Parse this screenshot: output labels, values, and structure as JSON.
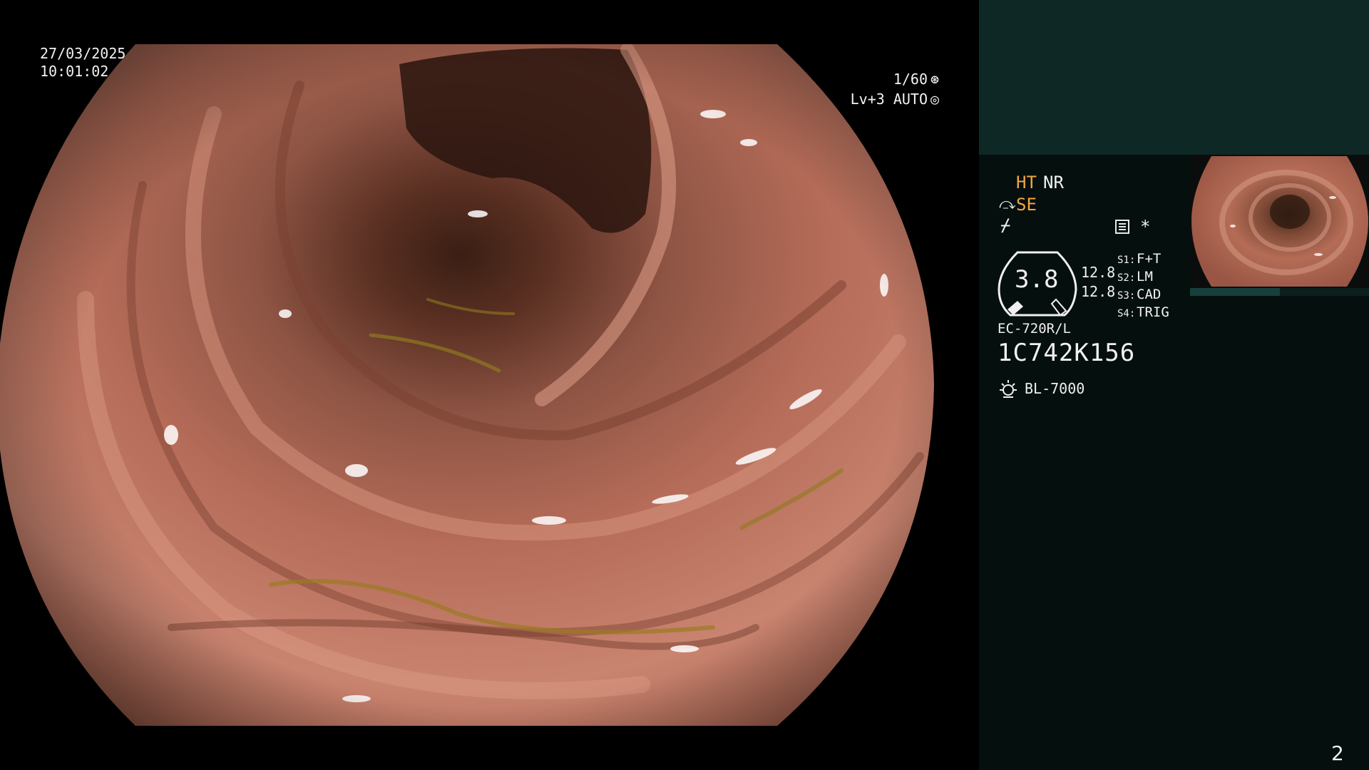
{
  "overlay": {
    "date": "27/03/2025",
    "time": "10:01:02",
    "shutter": "1/60",
    "shutter_icon": "shutter-icon",
    "level": "Lv+3 AUTO",
    "iris_icon": "iris-icon"
  },
  "panel": {
    "modes": {
      "ht": "HT",
      "nr": "NR",
      "se_symbol": "⤼",
      "se": "SE",
      "freeze_symbol": "⌿"
    },
    "menu_icon": "menu-icon",
    "asterisk": "*",
    "gauge": {
      "value": "3.8",
      "val_a": "12.8",
      "val_b": "12.8"
    },
    "switches": [
      {
        "key": "S1:",
        "value": "F+T"
      },
      {
        "key": "S2:",
        "value": "LM"
      },
      {
        "key": "S3:",
        "value": "CAD"
      },
      {
        "key": "S4:",
        "value": "TRIG"
      }
    ],
    "scope_model": "EC-720R/L",
    "scope_serial": "1C742K156",
    "light_icon": "light-source-icon",
    "light_source": "BL-7000",
    "page_number": "2"
  },
  "colors": {
    "accent": "#f2a640",
    "panel_top": "#0e2826",
    "panel_bg": "#050f0e",
    "mucosa": "#b86a55"
  }
}
